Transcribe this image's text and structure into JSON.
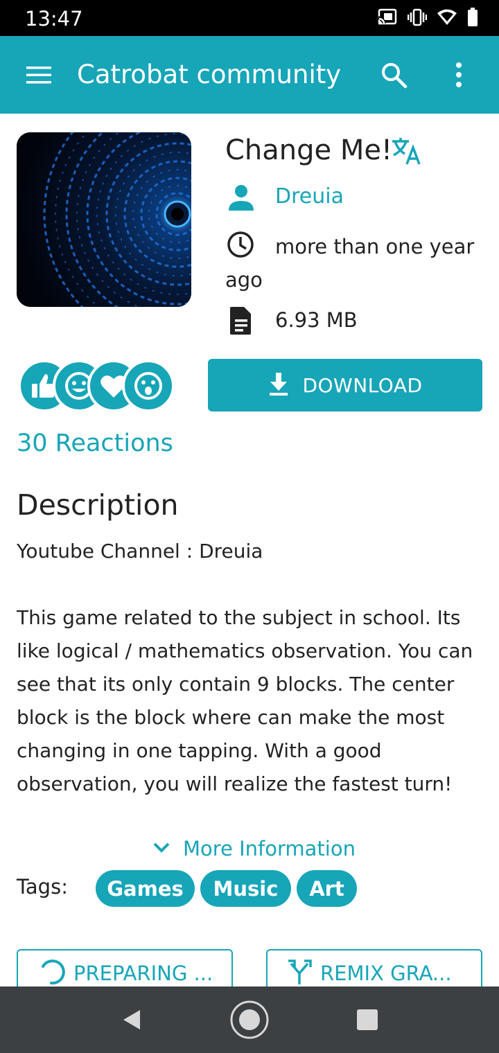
{
  "status_bar": {
    "time": "13:47",
    "icons": [
      "cast-icon",
      "vibrate-icon",
      "wifi-icon",
      "battery-icon"
    ]
  },
  "app_bar": {
    "title": "Catrobat community",
    "menu_icon": "hamburger-menu-icon",
    "search_icon": "search-icon",
    "overflow_icon": "more-vert-icon"
  },
  "project": {
    "title": "Change Me!",
    "translate_icon": "translate-icon",
    "author": "Dreuia",
    "uploaded": "more than one year ago",
    "size": "6.93 MB",
    "download_label": "DOWNLOAD",
    "reactions_label": "30 Reactions",
    "reaction_icons": [
      "thumbs-up-icon",
      "smile-icon",
      "heart-icon",
      "wow-icon"
    ]
  },
  "description": {
    "heading": "Description",
    "paragraphs": [
      "Youtube Channel : Dreuia",
      "This game related to the subject in school. Its like logical / mathematics observation. You can see that its only contain 9 blocks. The center block is the block where can make the most changing in one tapping. With a good observation, you will realize the fastest turn!"
    ],
    "more_info_label": "More Information"
  },
  "tags": {
    "label": "Tags:",
    "items": [
      "Games",
      "Music",
      "Art"
    ]
  },
  "actions": {
    "preparing_label": "PREPARING ...",
    "remix_label": "REMIX GRA..."
  },
  "colors": {
    "accent": "#17a5b8",
    "status_bar": "#000000",
    "nav_bar": "#3c4043",
    "text": "#222222"
  }
}
